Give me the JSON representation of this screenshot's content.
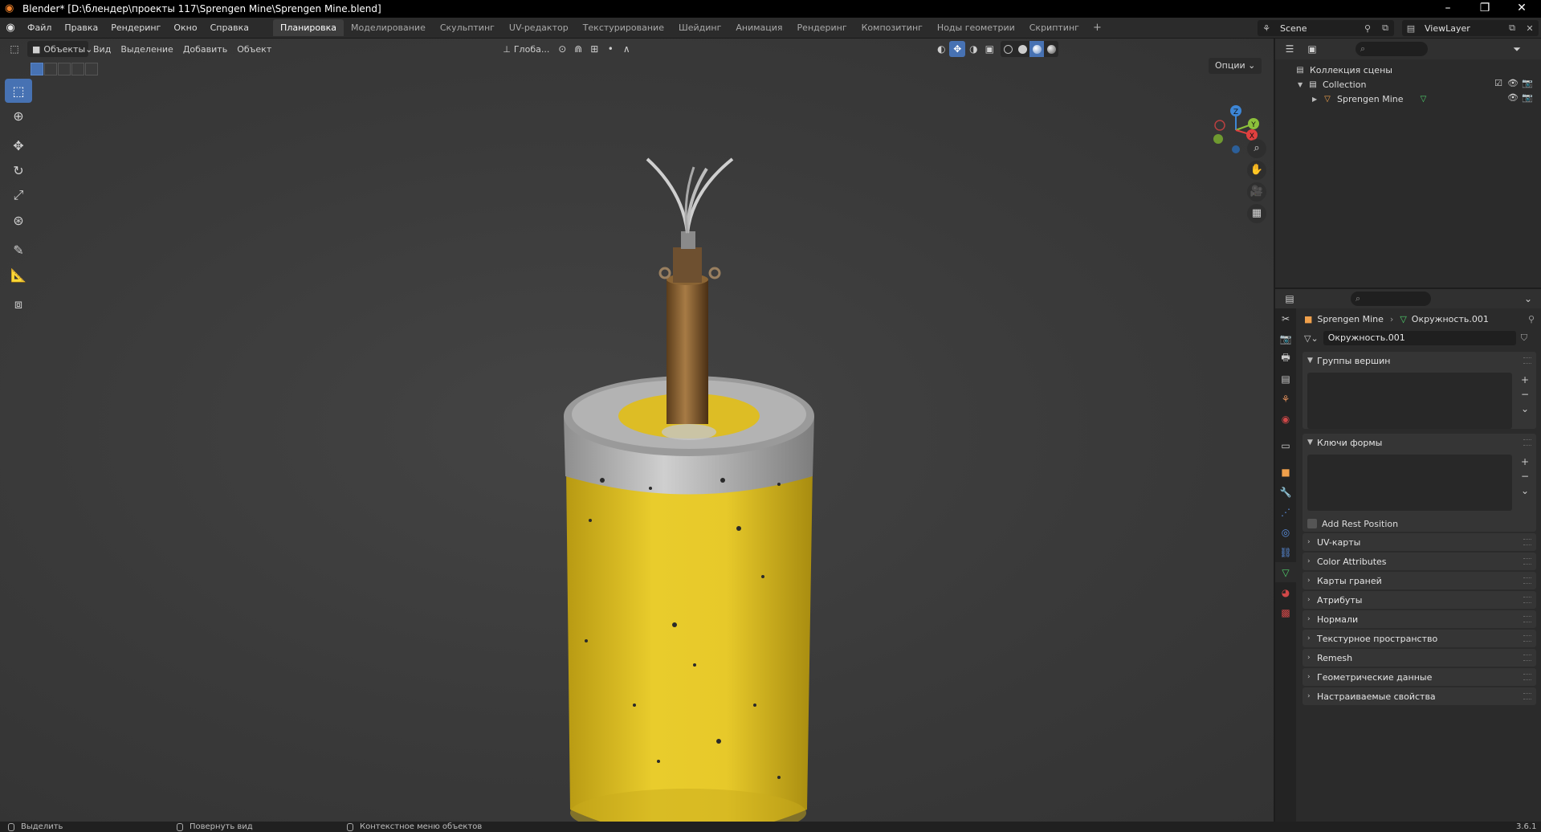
{
  "titlebar": {
    "title": "Blender* [D:\\блендер\\проекты 117\\Sprengen Mine\\Sprengen Mine.blend]",
    "minimize": "–",
    "maximize": "❐",
    "close": "✕"
  },
  "menus": [
    "Файл",
    "Правка",
    "Рендеринг",
    "Окно",
    "Справка"
  ],
  "workspaces": [
    "Планировка",
    "Моделирование",
    "Скульптинг",
    "UV-редактор",
    "Текстурирование",
    "Шейдинг",
    "Анимация",
    "Рендеринг",
    "Композитинг",
    "Ноды геометрии",
    "Скриптинг"
  ],
  "active_workspace": "Планировка",
  "scene": "Scene",
  "view_layer": "ViewLayer",
  "viewport": {
    "mode": "Объекты",
    "menus": [
      "Вид",
      "Выделение",
      "Добавить",
      "Объект"
    ],
    "transform_orientation": "Глоба...",
    "options": "Опции"
  },
  "gizmo_axes": {
    "z": "Z",
    "y": "Y",
    "x": "X"
  },
  "outliner": {
    "root": "Коллекция сцены",
    "collection": "Collection",
    "object": "Sprengen Mine"
  },
  "properties": {
    "object_name": "Sprengen Mine",
    "mesh_name": "Окружность.001",
    "mesh_field": "Окружность.001",
    "vertex_groups": "Группы вершин",
    "shape_keys": "Ключи формы",
    "add_rest_position": "Add Rest Position",
    "panels": [
      "UV-карты",
      "Color Attributes",
      "Карты граней",
      "Атрибуты",
      "Нормали",
      "Текстурное пространство",
      "Remesh",
      "Геометрические данные",
      "Настраиваемые свойства"
    ]
  },
  "status": {
    "left": "Выделить",
    "middle": "Повернуть вид",
    "right": "Контекстное меню объектов",
    "version": "3.6.1"
  },
  "colors": {
    "accent": "#4772b3",
    "mine_yellow": "#e6c627",
    "axis_x": "#e0403f",
    "axis_y": "#8cc03b",
    "axis_z": "#3d86d6"
  }
}
